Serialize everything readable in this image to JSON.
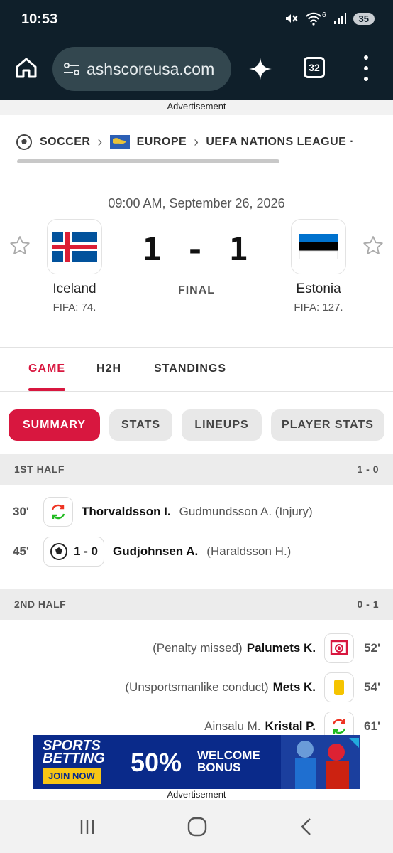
{
  "status_bar": {
    "time": "10:53",
    "network_sup": "6",
    "battery": "35"
  },
  "browser": {
    "url": "ashscoreusa.com",
    "tab_count": "32"
  },
  "ads": {
    "top_label": "Advertisement",
    "bottom_label": "Advertisement",
    "banner": {
      "brand_line1": "SPORTS",
      "brand_line2": "BETTING",
      "cta": "JOIN NOW",
      "percent": "50%",
      "offer_line1": "WELCOME",
      "offer_line2": "BONUS"
    }
  },
  "breadcrumb": {
    "sport": "SOCCER",
    "region": "EUROPE",
    "league": "UEFA NATIONS LEAGUE ·"
  },
  "match": {
    "datetime": "09:00 AM, September 26, 2026",
    "home": {
      "name": "Iceland",
      "rank": "FIFA: 74."
    },
    "away": {
      "name": "Estonia",
      "rank": "FIFA: 127."
    },
    "score": "1 - 1",
    "status": "FINAL"
  },
  "tabs": [
    "GAME",
    "H2H",
    "STANDINGS"
  ],
  "pills": [
    "SUMMARY",
    "STATS",
    "LINEUPS",
    "PLAYER STATS"
  ],
  "first_half": {
    "label": "1ST HALF",
    "score": "1 - 0",
    "events": [
      {
        "minute": "30'",
        "type": "substitution",
        "player": "Thorvaldsson I.",
        "secondary": "Gudmundsson A. (Injury)"
      },
      {
        "minute": "45'",
        "type": "goal",
        "score": "1 - 0",
        "player": "Gudjohnsen A.",
        "secondary": "(Haraldsson H.)"
      }
    ]
  },
  "second_half": {
    "label": "2ND HALF",
    "score": "0 - 1",
    "events": [
      {
        "minute": "52'",
        "type": "penalty-missed",
        "player": "Palumets K.",
        "secondary": "(Penalty missed)"
      },
      {
        "minute": "54'",
        "type": "yellow-card",
        "player": "Mets K.",
        "secondary": "(Unsportsmanlike conduct)"
      },
      {
        "minute": "61'",
        "type": "substitution",
        "player": "Kristal P.",
        "secondary": "Ainsalu M."
      }
    ]
  },
  "colors": {
    "accent": "#d8173f",
    "header_bg": "#0f1f2a"
  }
}
